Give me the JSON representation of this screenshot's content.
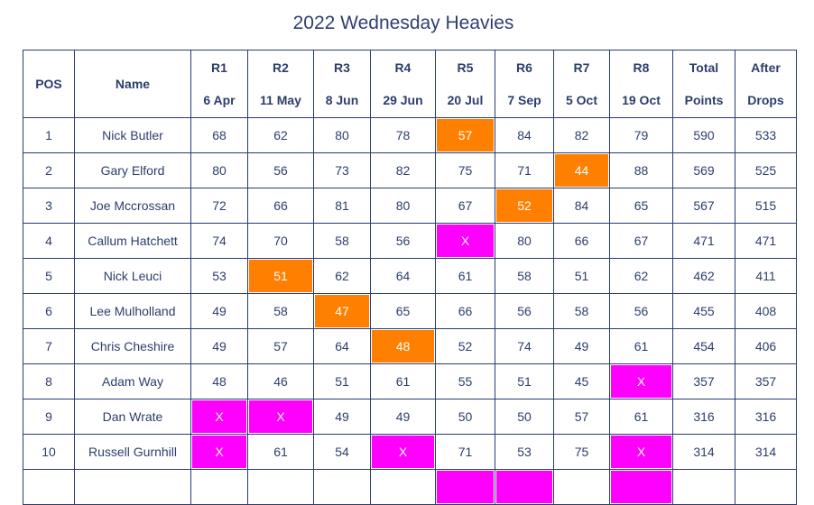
{
  "title": "2022 Wednesday Heavies",
  "colors": {
    "dropped_score": "#ff8000",
    "absent": "#ff00ff",
    "border": "#2b3a74",
    "text": "#2c3e6b"
  },
  "columns": {
    "pos": "POS",
    "name": "Name",
    "rounds": [
      {
        "round": "R1",
        "date": "6 Apr"
      },
      {
        "round": "R2",
        "date": "11 May"
      },
      {
        "round": "R3",
        "date": "8 Jun"
      },
      {
        "round": "R4",
        "date": "29 Jun"
      },
      {
        "round": "R5",
        "date": "20 Jul"
      },
      {
        "round": "R6",
        "date": "7 Sep"
      },
      {
        "round": "R7",
        "date": "5 Oct"
      },
      {
        "round": "R8",
        "date": "19 Oct"
      }
    ],
    "total": {
      "l1": "Total",
      "l2": "Points"
    },
    "after": {
      "l1": "After",
      "l2": "Drops"
    }
  },
  "rows": [
    {
      "pos": "1",
      "name": "Nick Butler",
      "scores": [
        "68",
        "62",
        "80",
        "78",
        "57",
        "84",
        "82",
        "79"
      ],
      "status": [
        "",
        "",
        "",
        "",
        "drop",
        "",
        "",
        ""
      ],
      "total": "590",
      "after": "533"
    },
    {
      "pos": "2",
      "name": "Gary Elford",
      "scores": [
        "80",
        "56",
        "73",
        "82",
        "75",
        "71",
        "44",
        "88"
      ],
      "status": [
        "",
        "",
        "",
        "",
        "",
        "",
        "drop",
        ""
      ],
      "total": "569",
      "after": "525"
    },
    {
      "pos": "3",
      "name": "Joe Mccrossan",
      "scores": [
        "72",
        "66",
        "81",
        "80",
        "67",
        "52",
        "84",
        "65"
      ],
      "status": [
        "",
        "",
        "",
        "",
        "",
        "drop",
        "",
        ""
      ],
      "total": "567",
      "after": "515"
    },
    {
      "pos": "4",
      "name": "Callum Hatchett",
      "scores": [
        "74",
        "70",
        "58",
        "56",
        "X",
        "80",
        "66",
        "67"
      ],
      "status": [
        "",
        "",
        "",
        "",
        "absent",
        "",
        "",
        ""
      ],
      "total": "471",
      "after": "471"
    },
    {
      "pos": "5",
      "name": "Nick Leuci",
      "scores": [
        "53",
        "51",
        "62",
        "64",
        "61",
        "58",
        "51",
        "62"
      ],
      "status": [
        "",
        "drop",
        "",
        "",
        "",
        "",
        "",
        ""
      ],
      "total": "462",
      "after": "411"
    },
    {
      "pos": "6",
      "name": "Lee Mulholland",
      "scores": [
        "49",
        "58",
        "47",
        "65",
        "66",
        "56",
        "58",
        "56"
      ],
      "status": [
        "",
        "",
        "drop",
        "",
        "",
        "",
        "",
        ""
      ],
      "total": "455",
      "after": "408"
    },
    {
      "pos": "7",
      "name": "Chris Cheshire",
      "scores": [
        "49",
        "57",
        "64",
        "48",
        "52",
        "74",
        "49",
        "61"
      ],
      "status": [
        "",
        "",
        "",
        "drop",
        "",
        "",
        "",
        ""
      ],
      "total": "454",
      "after": "406"
    },
    {
      "pos": "8",
      "name": "Adam Way",
      "scores": [
        "48",
        "46",
        "51",
        "61",
        "55",
        "51",
        "45",
        "X"
      ],
      "status": [
        "",
        "",
        "",
        "",
        "",
        "",
        "",
        "absent"
      ],
      "total": "357",
      "after": "357"
    },
    {
      "pos": "9",
      "name": "Dan Wrate",
      "scores": [
        "X",
        "X",
        "49",
        "49",
        "50",
        "50",
        "57",
        "61"
      ],
      "status": [
        "absent",
        "absent",
        "",
        "",
        "",
        "",
        "",
        ""
      ],
      "total": "316",
      "after": "316"
    },
    {
      "pos": "10",
      "name": "Russell Gurnhill",
      "scores": [
        "X",
        "61",
        "54",
        "X",
        "71",
        "53",
        "75",
        "X"
      ],
      "status": [
        "absent",
        "",
        "",
        "absent",
        "",
        "",
        "",
        "absent"
      ],
      "total": "314",
      "after": "314"
    },
    {
      "pos": "",
      "name": "",
      "scores": [
        "",
        "",
        "",
        "",
        "",
        "",
        "",
        ""
      ],
      "status": [
        "",
        "",
        "",
        "",
        "absent",
        "absent",
        "",
        "absent"
      ],
      "total": "",
      "after": ""
    }
  ]
}
